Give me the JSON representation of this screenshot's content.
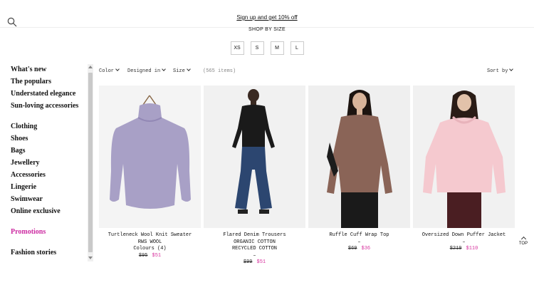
{
  "header": {
    "promo_link": "Sign up and get 10% off",
    "shop_by_size": "SHOP BY SIZE",
    "sizes": [
      "XS",
      "S",
      "M",
      "L"
    ]
  },
  "sidebar": {
    "items": [
      "What's new",
      "The populars",
      "Understated elegance",
      "Sun-loving accessories",
      "Clothing",
      "Shoes",
      "Bags",
      "Jewellery",
      "Accessories",
      "Lingerie",
      "Swimwear",
      "Online exclusive",
      "Promotions",
      "Fashion stories"
    ]
  },
  "filters": {
    "color": "Color",
    "designed_in": "Designed in",
    "size": "Size",
    "items_count": "(565 items)",
    "sort_by": "Sort by"
  },
  "products": [
    {
      "name": "Turtleneck Wool Knit Sweater",
      "line2": "RWS WOOL",
      "line3": "Colours (4)",
      "line4": "",
      "old_price": "$95",
      "new_price": "$51"
    },
    {
      "name": "Flared Denim Trousers",
      "line2": "ORGANIC COTTON",
      "line3": "RECYCLED COTTON",
      "line4": "–",
      "old_price": "$99",
      "new_price": "$51"
    },
    {
      "name": "Ruffle Cuff Wrap Top",
      "line2": "–",
      "line3": "",
      "line4": "",
      "old_price": "$69",
      "new_price": "$36"
    },
    {
      "name": "Oversized Down Puffer Jacket",
      "line2": "–",
      "line3": "",
      "line4": "",
      "old_price": "$219",
      "new_price": "$110"
    }
  ],
  "top_button": "TOP",
  "colors": {
    "promo": "#cc2aa1",
    "sale_price": "#d8359f"
  }
}
